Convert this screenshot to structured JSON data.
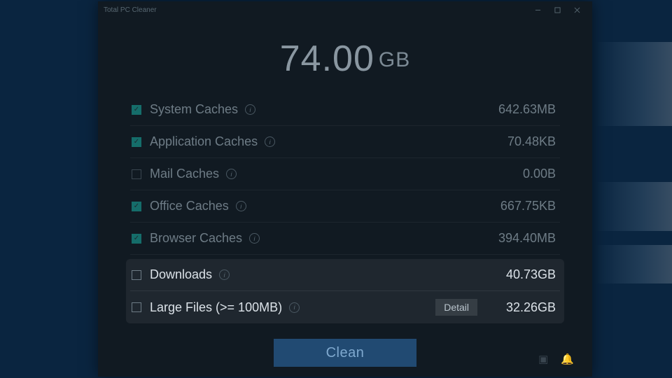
{
  "window": {
    "title": "Total PC Cleaner"
  },
  "total": {
    "value": "74.00",
    "unit": "GB"
  },
  "items": [
    {
      "label": "System Caches",
      "size": "642.63MB",
      "checked": true,
      "highlight": false,
      "detail": false
    },
    {
      "label": "Application Caches",
      "size": "70.48KB",
      "checked": true,
      "highlight": false,
      "detail": false
    },
    {
      "label": "Mail Caches",
      "size": "0.00B",
      "checked": false,
      "highlight": false,
      "detail": false
    },
    {
      "label": "Office Caches",
      "size": "667.75KB",
      "checked": true,
      "highlight": false,
      "detail": false
    },
    {
      "label": "Browser Caches",
      "size": "394.40MB",
      "checked": true,
      "highlight": false,
      "detail": false
    },
    {
      "label": "Downloads",
      "size": "40.73GB",
      "checked": false,
      "highlight": true,
      "detail": false
    },
    {
      "label": "Large Files (>= 100MB)",
      "size": "32.26GB",
      "checked": false,
      "highlight": true,
      "detail": true
    }
  ],
  "buttons": {
    "clean": "Clean",
    "detail": "Detail"
  },
  "colors": {
    "accent": "#214a72",
    "check": "#156d6a"
  }
}
